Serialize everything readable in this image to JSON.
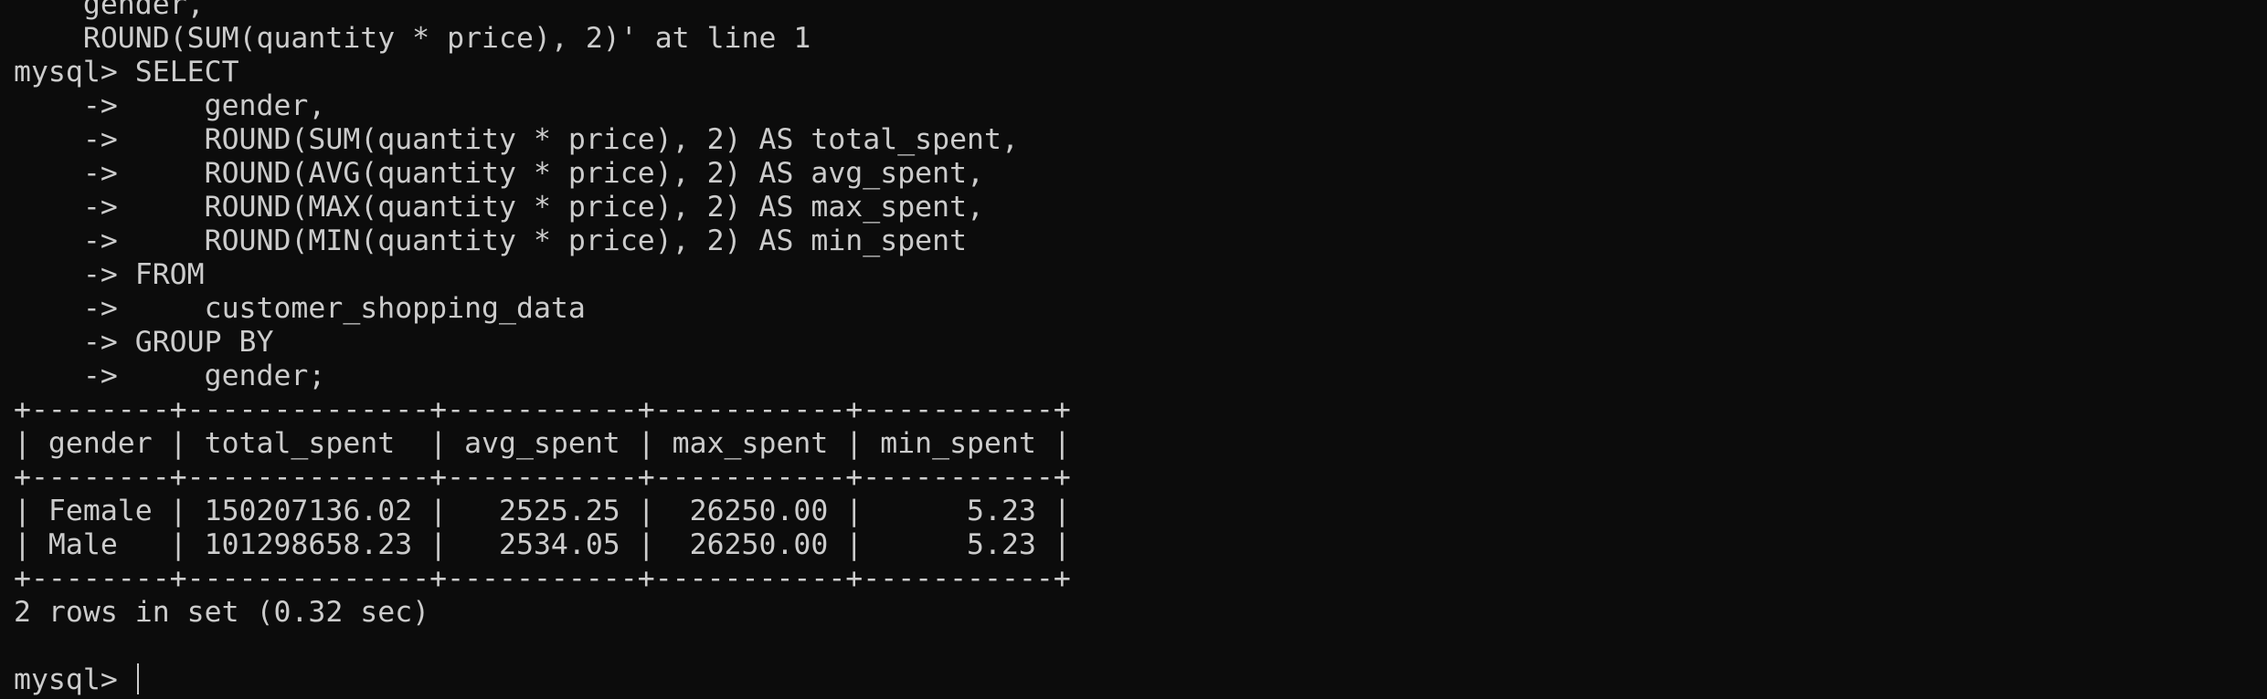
{
  "terminal": {
    "previous_output": [
      "    gender,",
      "    ROUND(SUM(quantity * price), 2)' at line 1"
    ],
    "query_lines": [
      "mysql> SELECT",
      "    ->     gender,",
      "    ->     ROUND(SUM(quantity * price), 2) AS total_spent,",
      "    ->     ROUND(AVG(quantity * price), 2) AS avg_spent,",
      "    ->     ROUND(MAX(quantity * price), 2) AS max_spent,",
      "    ->     ROUND(MIN(quantity * price), 2) AS min_spent",
      "    -> FROM",
      "    ->     customer_shopping_data",
      "    -> GROUP BY",
      "    ->     gender;"
    ],
    "result_table": {
      "border": "+--------+--------------+-----------+-----------+-----------+",
      "header": "| gender | total_spent  | avg_spent | max_spent | min_spent |",
      "rows": [
        "| Female | 150207136.02 |   2525.25 |  26250.00 |      5.23 |",
        "| Male   | 101298658.23 |   2534.05 |  26250.00 |      5.23 |"
      ],
      "columns": [
        "gender",
        "total_spent",
        "avg_spent",
        "max_spent",
        "min_spent"
      ],
      "data": [
        [
          "Female",
          "150207136.02",
          "2525.25",
          "26250.00",
          "5.23"
        ],
        [
          "Male",
          "101298658.23",
          "2534.05",
          "26250.00",
          "5.23"
        ]
      ]
    },
    "status": "2 rows in set (0.32 sec)",
    "prompt": "mysql> ",
    "colors": {
      "background": "#0c0c0c",
      "foreground": "#cccccc"
    }
  }
}
